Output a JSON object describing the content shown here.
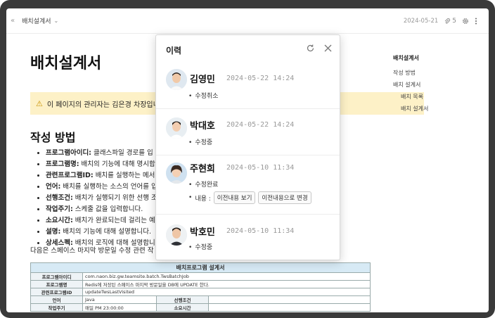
{
  "topbar": {
    "breadcrumb": "배치설계서",
    "date": "2024-05-21",
    "attachment_count": "5"
  },
  "document": {
    "title": "배치설계서",
    "notice": "이 페이지의 관리자는 김은경 차장입니",
    "section_heading": "작성 방법",
    "bullets": [
      "프로그램아이디: 클래스파일 경로를 입",
      "프로그램명: 배치의 기능에 대해 명시합",
      "관련프로그램ID: 배치를 실행하는 메서",
      "언어: 배치를 실행하는 소스의 언어를 입",
      "선행조건: 배치가 실행되기 위한 선행 조",
      "작업주기: 스케줄 값을 입력합니다.",
      "소요시간: 배치가 완료되는데 걸리는 예",
      "설명: 배치의 기능에 대해 설명합니다.",
      "상세스펙: 배치의 로직에 대해 설명합니다"
    ],
    "bullet_bold_labels": [
      "프로그램아이디:",
      "프로그램명:",
      "관련프로그램ID:",
      "언어:",
      "선행조건:",
      "작업주기:",
      "소요시간:",
      "설명:",
      "상세스펙:"
    ],
    "paragraph": "다음은 스페이스 마지막 방문일 수정 관련 작",
    "spec_table": {
      "title": "배치프로그램 설계서",
      "rows": [
        {
          "label": "프로그램아이디",
          "value": "com.naon.biz.gw.teamsite.batch.TwsBatchJob"
        },
        {
          "label": "프로그램명",
          "value": "Redis에 저장된 스페이스 마지막 방문일을 DB에 UPDATE 한다."
        },
        {
          "label": "관련프로그램ID",
          "value": "updateTwsLastVisited"
        },
        {
          "label": "언어",
          "value": "Java",
          "label2": "선행조건",
          "value2": ""
        },
        {
          "label": "작업주기",
          "value": "매일 PM 23:00:00",
          "label2": "소요시간",
          "value2": ""
        }
      ]
    }
  },
  "toc": {
    "title": "배치설계서",
    "items": [
      "작성 방법",
      "배치 설계서"
    ],
    "subitems": [
      "배치 목록",
      "배치 설계서"
    ]
  },
  "history": {
    "title": "이력",
    "entries": [
      {
        "name": "김영민",
        "time": "2024-05-22 14:24",
        "status": "수정취소"
      },
      {
        "name": "박대호",
        "time": "2024-05-22 14:24",
        "status": "수정중"
      },
      {
        "name": "주현희",
        "time": "2024-05-10 11:34",
        "status": "수정완료",
        "content_label": "내용 :",
        "btn_prev": "이전내용 보기",
        "btn_restore": "이전내용으로 변경"
      },
      {
        "name": "박호민",
        "time": "2024-05-10 11:34",
        "status": "수정중"
      }
    ]
  },
  "colors": {
    "notice_bg": "#fdf1c7",
    "table_header_bg": "#d7eaf5",
    "frame": "#3a3a3a"
  }
}
